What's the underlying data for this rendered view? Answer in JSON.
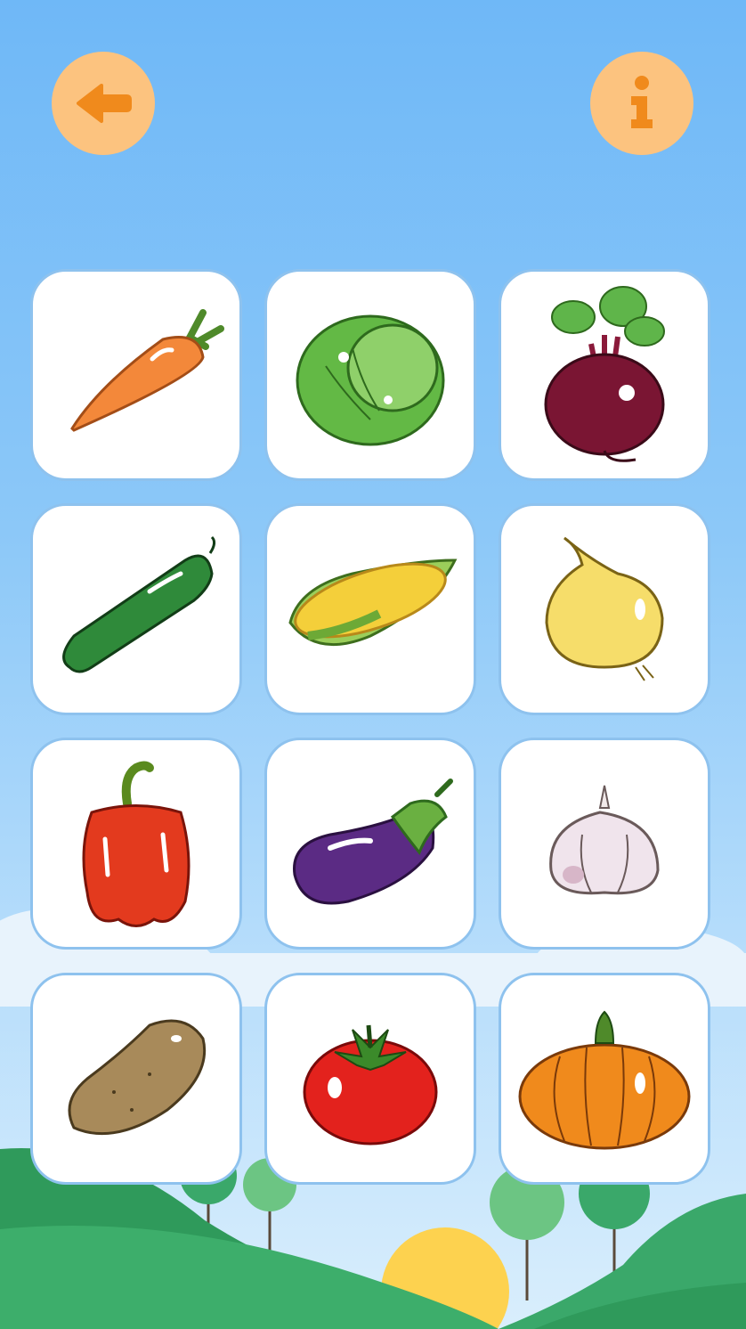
{
  "header": {
    "back_icon": "arrow-left-icon",
    "info_icon": "info-icon",
    "button_color": "#fcc37f",
    "icon_color": "#f08a1c"
  },
  "vegetables": [
    {
      "icon": "carrot-icon"
    },
    {
      "icon": "cabbage-icon"
    },
    {
      "icon": "beet-icon"
    },
    {
      "icon": "cucumber-icon"
    },
    {
      "icon": "corn-icon"
    },
    {
      "icon": "onion-icon"
    },
    {
      "icon": "bell-pepper-icon"
    },
    {
      "icon": "eggplant-icon"
    },
    {
      "icon": "garlic-icon"
    },
    {
      "icon": "potato-icon"
    },
    {
      "icon": "tomato-icon"
    },
    {
      "icon": "pumpkin-icon"
    }
  ]
}
